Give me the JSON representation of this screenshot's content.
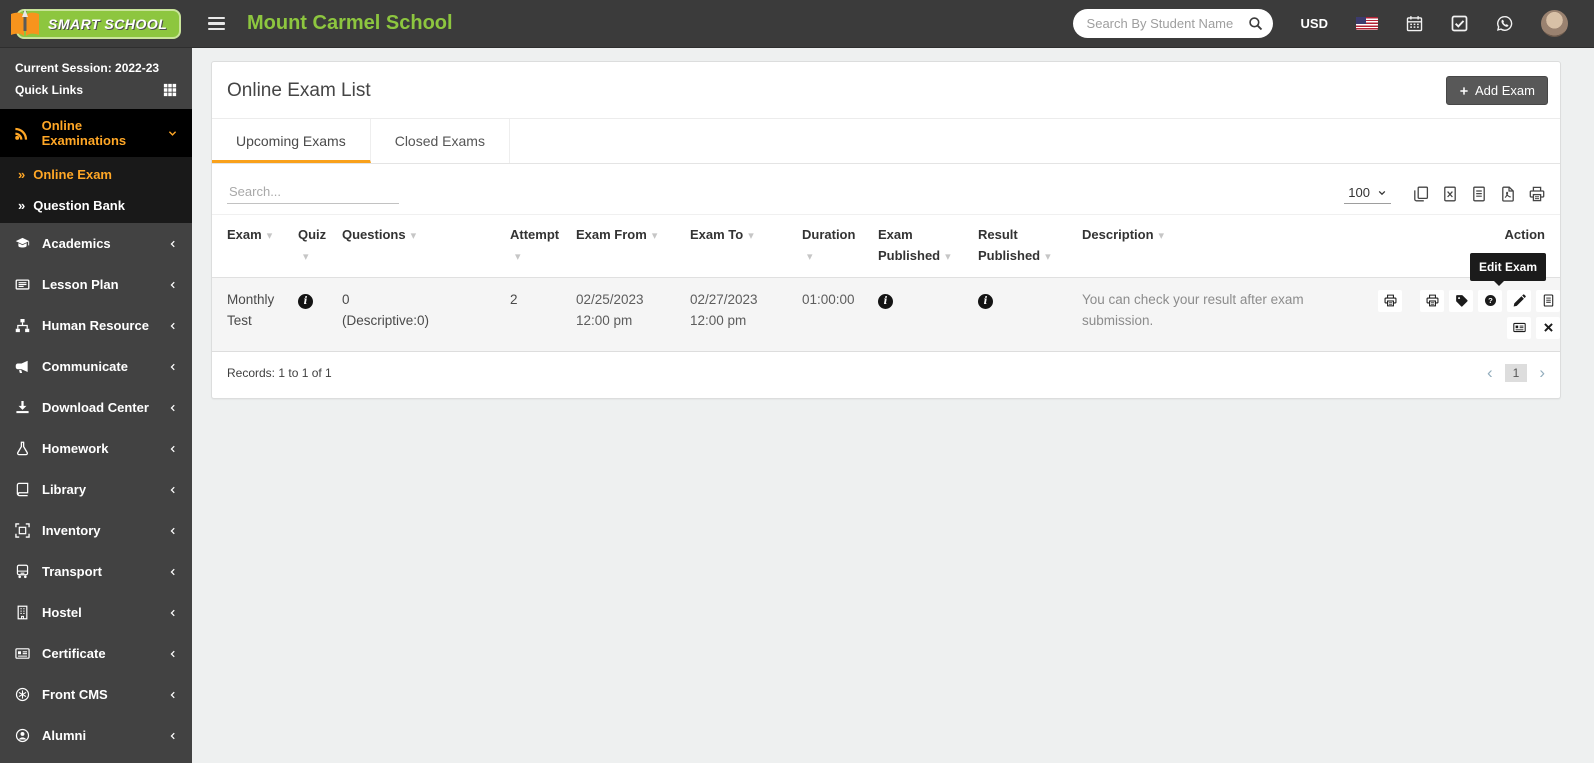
{
  "colors": {
    "accent_orange": "#ffa726",
    "tab_underline_orange": "#f9a11b",
    "brand_green": "#8dc63f",
    "header_bg": "#3b3b3b",
    "sidebar_bg": "#424242",
    "active_menu_bg": "#000000",
    "row_bg": "#f5f5f5",
    "tooltip_bg": "#1b1b1b"
  },
  "icons": {
    "sort_arrow_glyph": "▾",
    "submenu_bullet_glyph": "»",
    "pager_prev_glyph": "‹",
    "pager_next_glyph": "›",
    "info_glyph": "i"
  },
  "header": {
    "logo_text": "SMART SCHOOL",
    "school_name": "Mount Carmel School",
    "search_placeholder": "Search By Student Name",
    "currency_label": "USD"
  },
  "sidebar": {
    "session_label": "Current Session: 2022-23",
    "quick_links_label": "Quick Links",
    "active_group": {
      "label": "Online Examinations",
      "icon": "rss"
    },
    "submenu": [
      {
        "label": "Online Exam",
        "active": true
      },
      {
        "label": "Question Bank",
        "active": false
      }
    ],
    "items": [
      {
        "label": "Academics",
        "icon": "grad"
      },
      {
        "label": "Lesson Plan",
        "icon": "news"
      },
      {
        "label": "Human Resource",
        "icon": "sitemap"
      },
      {
        "label": "Communicate",
        "icon": "bullhorn"
      },
      {
        "label": "Download Center",
        "icon": "download"
      },
      {
        "label": "Homework",
        "icon": "flask"
      },
      {
        "label": "Library",
        "icon": "book"
      },
      {
        "label": "Inventory",
        "icon": "box"
      },
      {
        "label": "Transport",
        "icon": "bus"
      },
      {
        "label": "Hostel",
        "icon": "building"
      },
      {
        "label": "Certificate",
        "icon": "idcard"
      },
      {
        "label": "Front CMS",
        "icon": "cms"
      },
      {
        "label": "Alumni",
        "icon": "usercircle"
      }
    ]
  },
  "main": {
    "page_title": "Online Exam List",
    "add_exam_label": "Add Exam",
    "tabs": {
      "upcoming": "Upcoming Exams",
      "closed": "Closed Exams"
    },
    "toolbar": {
      "search_placeholder": "Search...",
      "page_size": "100"
    },
    "table": {
      "headers": {
        "exam": "Exam",
        "quiz": "Quiz",
        "questions": "Questions",
        "attempt": "Attempt",
        "exam_from": "Exam From",
        "exam_to": "Exam To",
        "duration": "Duration",
        "exam_published": "Exam Published",
        "result_published": "Result Published",
        "description": "Description",
        "action": "Action"
      },
      "row": {
        "exam": "Monthly Test",
        "questions": "0",
        "questions_detail": "(Descriptive:0)",
        "attempt": "2",
        "exam_from_date": "02/25/2023",
        "exam_from_time": "12:00 pm",
        "exam_to_date": "02/27/2023",
        "exam_to_time": "12:00 pm",
        "duration": "01:00:00",
        "description": "You can check your result after exam submission."
      },
      "records_text": "Records: 1 to 1 of 1",
      "page": "1"
    },
    "tooltip": {
      "edit_exam": "Edit Exam"
    }
  }
}
